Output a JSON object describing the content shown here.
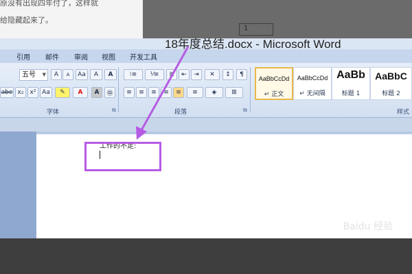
{
  "article": {
    "line1": "原没有出现四年付了，这样就",
    "line2": "给隐藏起来了。"
  },
  "inset": {
    "label": "1"
  },
  "window": {
    "title": "18年度总结.docx - Microsoft Word"
  },
  "ribbon_tabs": [
    "引用",
    "邮件",
    "审阅",
    "视图",
    "开发工具"
  ],
  "font_group": {
    "size_value": "五号",
    "name": "字体",
    "buttons": [
      "A",
      "A",
      "Aa",
      "A",
      "abe",
      "x₂",
      "x²",
      "Aa",
      "A",
      "A"
    ]
  },
  "paragraph_group": {
    "name": "段落",
    "buttons": [
      "≡",
      "≡",
      "≡",
      "≡",
      "≡",
      "≡"
    ]
  },
  "styles_group": {
    "name": "样式",
    "items": [
      {
        "sample": "AaBbCcDd",
        "label": "↵ 正文"
      },
      {
        "sample": "AaBbCcDd",
        "label": "↵ 无间隔"
      },
      {
        "sample": "AaBb",
        "label": "标题 1"
      },
      {
        "sample": "AaBbC",
        "label": "标题 2"
      }
    ]
  },
  "document": {
    "text": "工作的不足:"
  },
  "watermark": {
    "text": "Baidu 经验"
  },
  "colors": {
    "highlight": "#b65be4",
    "accent": "#e9b84a"
  }
}
